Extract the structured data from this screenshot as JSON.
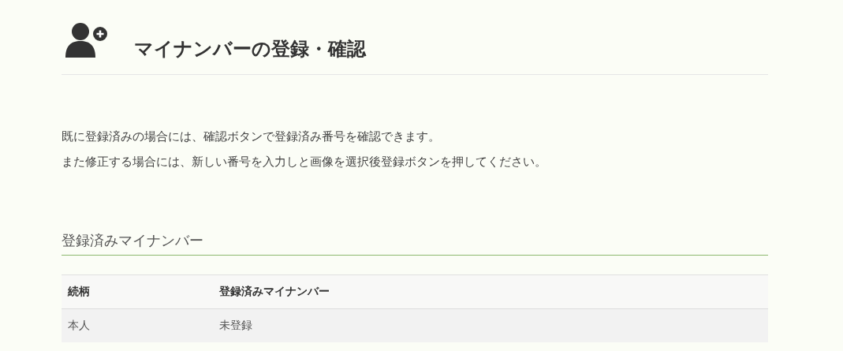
{
  "page_title": "マイナンバーの登録・確認",
  "intro": [
    "既に登録済みの場合には、確認ボタンで登録済み番号を確認できます。",
    "また修正する場合には、新しい番号を入力しと画像を選択後登録ボタンを押してください。"
  ],
  "section": {
    "title": "登録済みマイナンバー",
    "table": {
      "columns": [
        "続柄",
        "登録済みマイナンバー"
      ],
      "rows": [
        [
          "本人",
          "未登録"
        ]
      ]
    }
  }
}
